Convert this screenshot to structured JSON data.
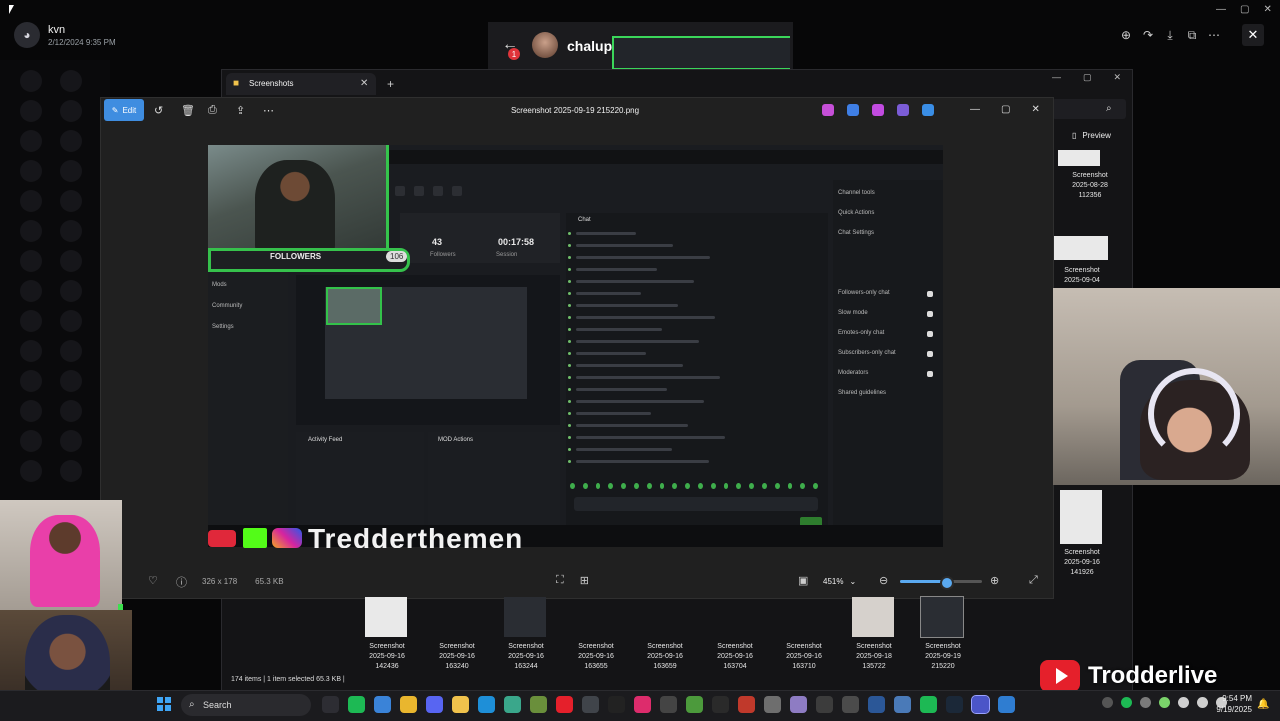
{
  "discord": {
    "username": "kvn",
    "date": "2/12/2024 9:35 PM",
    "logo_glyph": "◕"
  },
  "viewer_toolbar": {
    "icons": [
      "zoom-in-icon",
      "forward-icon",
      "download-icon",
      "open-external-icon",
      "more-icon"
    ],
    "glyphs": [
      "⊕",
      "↷",
      "⤓",
      "⧉",
      "⋯"
    ],
    "close_glyph": "✕"
  },
  "system_controls": [
    "—",
    "▢",
    "✕"
  ],
  "chat": {
    "back_glyph": "←",
    "badge": "1",
    "name": "chalup"
  },
  "explorer": {
    "tab_label": "Screenshots",
    "tab_icon_glyph": "■",
    "tab_close": "✕",
    "new_tab": "+",
    "window_controls": [
      "—",
      "▢",
      "✕"
    ],
    "search_glyph": "⌕",
    "preview_label": "Preview",
    "preview_glyph": "▯",
    "status": "174 items  |  1 item selected  65.3 KB  |",
    "right_items": [
      {
        "name": "Screenshot",
        "date": "2025-08-28",
        "time": "112356"
      },
      {
        "name": "Screenshot",
        "date": "2025-09-04",
        "time": ""
      },
      {
        "name": "Screenshot",
        "date": "2025-09-16",
        "time": "141926"
      }
    ],
    "bottom_items": [
      {
        "name": "Screenshot",
        "date": "2025-09-16",
        "time": "142436"
      },
      {
        "name": "Screenshot",
        "date": "2025-09-16",
        "time": "163240"
      },
      {
        "name": "Screenshot",
        "date": "2025-09-16",
        "time": "163244"
      },
      {
        "name": "Screenshot",
        "date": "2025-09-16",
        "time": "163655"
      },
      {
        "name": "Screenshot",
        "date": "2025-09-16",
        "time": "163659"
      },
      {
        "name": "Screenshot",
        "date": "2025-09-16",
        "time": "163704"
      },
      {
        "name": "Screenshot",
        "date": "2025-09-16",
        "time": "163710"
      },
      {
        "name": "Screenshot",
        "date": "2025-09-18",
        "time": "135722"
      },
      {
        "name": "Screenshot",
        "date": "2025-09-19",
        "time": "215220"
      }
    ]
  },
  "photos": {
    "edit_label": "Edit",
    "edit_glyph": "✎",
    "title": "Screenshot 2025-09-19 215220.png",
    "tools": {
      "rotate": "↺",
      "delete": "🗑",
      "print": "⎙",
      "share": "⇪",
      "more": "⋯"
    },
    "app_icons": [
      {
        "name": "copilot-icon",
        "color": "#c64fd8"
      },
      {
        "name": "designer-icon",
        "color": "#3f7fe5"
      },
      {
        "name": "clipchamp-icon",
        "color": "#c24be0"
      },
      {
        "name": "teams-icon",
        "color": "#7b5cd6"
      },
      {
        "name": "onedrive-icon",
        "color": "#3a8ee6"
      }
    ],
    "window_controls": [
      "—",
      "▢",
      "✕"
    ],
    "dims": "326 x 178",
    "size": "65.3 KB",
    "zoom": "451%",
    "zoom_fraction": 0.55,
    "heart_glyph": "♡",
    "info_glyph": "ⓘ",
    "mid_glyphs": [
      "⛶",
      "⊞"
    ],
    "fit_glyph": "▣",
    "zoom_out_glyph": "⊖",
    "zoom_in_glyph": "⊕",
    "chevron": "⌄",
    "fullscreen_glyph": "⤢"
  },
  "canvas": {
    "followers_label": "FOLLOWERS",
    "followers_count": "106",
    "stat1": "43",
    "stat2": "00:17:58",
    "stat1_label": "Followers",
    "stat2_label": "Session",
    "nav": [
      "Mods",
      "Community",
      "Settings"
    ],
    "activity_title": "Activity Feed",
    "mod_title": "MOD Actions",
    "chat_title": "Chat",
    "right_items": [
      "Channel tools",
      "Quick Actions",
      "Chat Settings",
      "Followers-only chat",
      "Slow mode",
      "Emotes-only chat",
      "Subscribers-only chat",
      "Moderators",
      "Shared guidelines"
    ],
    "banner_text": "Tredderthemen"
  },
  "brand": {
    "name": "Trodderlive"
  },
  "taskbar": {
    "search_label": "Search",
    "search_glyph": "⌕",
    "apps": [
      {
        "name": "obs-icon",
        "color": "#2d2d33"
      },
      {
        "name": "spotify-icon",
        "color": "#1db954"
      },
      {
        "name": "photos-icon",
        "color": "#3a83d8"
      },
      {
        "name": "chrome-icon",
        "color": "#e9b62e"
      },
      {
        "name": "discord-icon",
        "color": "#5865f2"
      },
      {
        "name": "explorer-icon",
        "color": "#f0c24c"
      },
      {
        "name": "edge-icon",
        "color": "#1e8fd8"
      },
      {
        "name": "app-icon",
        "color": "#3aa78b"
      },
      {
        "name": "app2-icon",
        "color": "#6a8f3b"
      },
      {
        "name": "youtube-icon",
        "color": "#e5202b"
      },
      {
        "name": "app3-icon",
        "color": "#40444a"
      },
      {
        "name": "epic-icon",
        "color": "#222"
      },
      {
        "name": "app4-icon",
        "color": "#dd2c6c"
      },
      {
        "name": "app5-icon",
        "color": "#444"
      },
      {
        "name": "minecraft-icon",
        "color": "#4c9a3c"
      },
      {
        "name": "ez-icon",
        "color": "#2a2a2a"
      },
      {
        "name": "app6-icon",
        "color": "#c0392b"
      },
      {
        "name": "app7-icon",
        "color": "#6e6e6e"
      },
      {
        "name": "app8-icon",
        "color": "#8e7cc3"
      },
      {
        "name": "app9-icon",
        "color": "#3c3c3c"
      },
      {
        "name": "app10-icon",
        "color": "#4b4b4b"
      },
      {
        "name": "app11-icon",
        "color": "#2b5797"
      },
      {
        "name": "app12-icon",
        "color": "#4a7ab8"
      },
      {
        "name": "spotify2-icon",
        "color": "#1db954"
      },
      {
        "name": "steam-icon",
        "color": "#1b2838"
      },
      {
        "name": "active-app-icon",
        "color": "#4b55c8"
      },
      {
        "name": "app13-icon",
        "color": "#2f7dd1"
      }
    ],
    "tray": [
      {
        "name": "chevron-up-icon",
        "color": "#555"
      },
      {
        "name": "spotify-tray-icon",
        "color": "#1db954"
      },
      {
        "name": "app-tray-icon",
        "color": "#7a7a7a"
      },
      {
        "name": "mic-icon",
        "color": "#7ad36a"
      },
      {
        "name": "wifi-icon",
        "color": "#cfcfcf"
      },
      {
        "name": "volume-icon",
        "color": "#cfcfcf"
      },
      {
        "name": "battery-icon",
        "color": "#cfcfcf"
      }
    ],
    "time": "9:54 PM",
    "date": "9/19/2025",
    "bell_glyph": "🔔"
  }
}
